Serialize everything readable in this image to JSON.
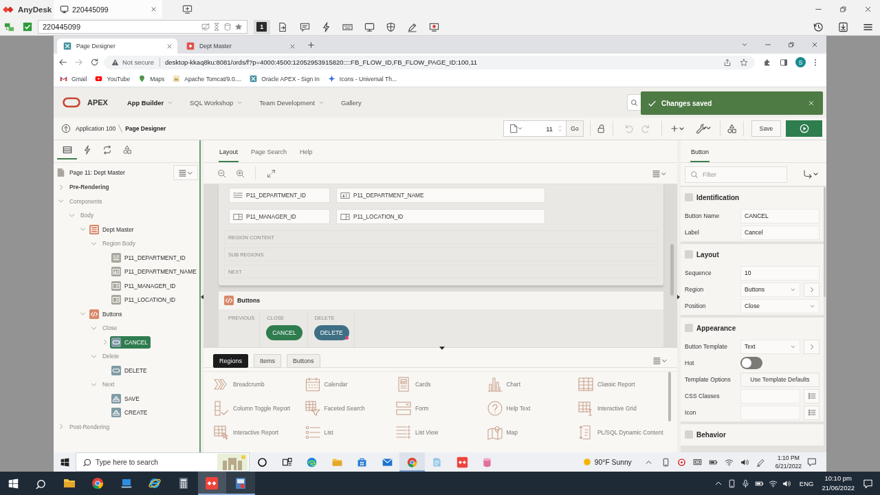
{
  "anydesk": {
    "app_name": "AnyDesk",
    "session_tab": "220445099",
    "address": "220445099",
    "tools": [
      {
        "kind": "display",
        "label": "1",
        "selected": true
      },
      {
        "kind": "transfer",
        "selected": false
      },
      {
        "kind": "chat",
        "selected": false
      },
      {
        "kind": "actions",
        "selected": false
      },
      {
        "kind": "keyboard",
        "selected": false
      },
      {
        "kind": "monitor",
        "selected": false
      },
      {
        "kind": "privacy",
        "selected": false
      },
      {
        "kind": "whiteboard",
        "selected": false
      },
      {
        "kind": "record",
        "selected": false
      }
    ]
  },
  "browser": {
    "tabs": [
      {
        "title": "Page Designer",
        "kind": "apex",
        "selected": true
      },
      {
        "title": "Dept Master",
        "kind": "app",
        "selected": false
      }
    ],
    "security": "Not secure",
    "url": "desktop-kkaq8ku:8081/ords/f?p=4000:4500:12052953915820::::FB_FLOW_ID,FB_FLOW_PAGE_ID:100,11",
    "profile": "S",
    "bookmarks": [
      {
        "label": "Gmail",
        "kind": "gmail"
      },
      {
        "label": "YouTube",
        "kind": "youtube"
      },
      {
        "label": "Maps",
        "kind": "maps"
      },
      {
        "label": "Apache Tomcat/9.0....",
        "kind": "tomcat"
      },
      {
        "label": "Oracle APEX - Sign In",
        "kind": "apex"
      },
      {
        "label": "Icons - Universal Th...",
        "kind": "star"
      }
    ]
  },
  "apex": {
    "brand": "APEX",
    "menus": [
      {
        "label": "App Builder",
        "selected": true,
        "dropdown": true
      },
      {
        "label": "SQL Workshop",
        "selected": false,
        "dropdown": true
      },
      {
        "label": "Team Development",
        "selected": false,
        "dropdown": true
      },
      {
        "label": "Gallery",
        "selected": false,
        "dropdown": false
      }
    ],
    "toast": "Changes saved",
    "breadcrumb": [
      {
        "label": "Application 100",
        "current": false
      },
      {
        "label": "Page Designer",
        "current": true
      }
    ],
    "page_number": "11",
    "go": "Go",
    "history_buttons": [
      {
        "kind": "undo",
        "disabled": true
      },
      {
        "kind": "redo",
        "disabled": true
      }
    ],
    "save": "Save"
  },
  "tree": {
    "tabs": [
      {
        "kind": "rendering",
        "selected": true
      },
      {
        "kind": "dynamic_actions",
        "selected": false
      },
      {
        "kind": "processing",
        "selected": false
      },
      {
        "kind": "shared_components",
        "selected": false
      }
    ],
    "root": "Page 11: Dept Master",
    "nodes": [
      {
        "label": "Pre-Rendering",
        "kind": "heading",
        "expanded": false,
        "selected": false
      },
      {
        "label": "Components",
        "kind": "folder",
        "expanded": true,
        "selected": false,
        "children": [
          {
            "label": "Body",
            "kind": "folder",
            "expanded": true,
            "selected": false,
            "children": [
              {
                "label": "Dept Master",
                "kind": "region",
                "expanded": true,
                "selected": false,
                "children": [
                  {
                    "label": "Region Body",
                    "kind": "folder",
                    "expanded": true,
                    "selected": false,
                    "children": [
                      {
                        "label": "P11_DEPARTMENT_ID",
                        "kind": "text_item",
                        "selected": false
                      },
                      {
                        "label": "P11_DEPARTMENT_NAME",
                        "kind": "display_item",
                        "selected": false
                      },
                      {
                        "label": "P11_MANAGER_ID",
                        "kind": "select_item",
                        "selected": false
                      },
                      {
                        "label": "P11_LOCATION_ID",
                        "kind": "select_item",
                        "selected": false
                      }
                    ]
                  }
                ]
              },
              {
                "label": "Buttons",
                "kind": "code_region",
                "expanded": true,
                "selected": false,
                "children": [
                  {
                    "label": "Close",
                    "kind": "folder",
                    "expanded": true,
                    "selected": false,
                    "children": [
                      {
                        "label": "CANCEL",
                        "kind": "button",
                        "expanded": false,
                        "selected": true
                      }
                    ]
                  },
                  {
                    "label": "Delete",
                    "kind": "folder",
                    "expanded": true,
                    "selected": false,
                    "children": [
                      {
                        "label": "DELETE",
                        "kind": "button",
                        "selected": false
                      }
                    ]
                  },
                  {
                    "label": "Next",
                    "kind": "folder",
                    "expanded": true,
                    "selected": false,
                    "children": [
                      {
                        "label": "SAVE",
                        "kind": "submit_button",
                        "selected": false
                      },
                      {
                        "label": "CREATE",
                        "kind": "submit_button",
                        "selected": false
                      }
                    ]
                  }
                ]
              }
            ]
          }
        ]
      },
      {
        "label": "Post-Rendering",
        "kind": "folder",
        "expanded": false,
        "selected": false
      }
    ]
  },
  "layout": {
    "tabs": [
      {
        "label": "Layout",
        "selected": true
      },
      {
        "label": "Page Search",
        "selected": false
      },
      {
        "label": "Help",
        "selected": false
      }
    ],
    "item_rows": [
      [
        {
          "label": "P11_DEPARTMENT_ID",
          "kind": "text"
        },
        {
          "label": "P11_DEPARTMENT_NAME",
          "kind": "display"
        }
      ],
      [
        {
          "label": "P11_MANAGER_ID",
          "kind": "select"
        },
        {
          "label": "P11_LOCATION_ID",
          "kind": "select"
        }
      ]
    ],
    "positions": [
      "REGION CONTENT",
      "SUB REGIONS",
      "NEXT"
    ],
    "button_region": {
      "title": "Buttons",
      "positions": [
        {
          "label": "PREVIOUS"
        },
        {
          "label": "CLOSE",
          "buttons": [
            {
              "label": "CANCEL",
              "selected": true,
              "marker": false
            }
          ]
        },
        {
          "label": "DELETE",
          "buttons": [
            {
              "label": "DELETE",
              "selected": false,
              "marker": true
            }
          ]
        }
      ]
    }
  },
  "gallery": {
    "tabs": [
      {
        "label": "Regions",
        "selected": true
      },
      {
        "label": "Items",
        "selected": false
      },
      {
        "label": "Buttons",
        "selected": false
      }
    ],
    "items": [
      {
        "label": "Breadcrumb",
        "kind": "breadcrumb"
      },
      {
        "label": "Calendar",
        "kind": "calendar"
      },
      {
        "label": "Cards",
        "kind": "cards"
      },
      {
        "label": "Chart",
        "kind": "chart"
      },
      {
        "label": "Classic Report",
        "kind": "table"
      },
      {
        "label": "Column Toggle Report",
        "kind": "column_toggle"
      },
      {
        "label": "Faceted Search",
        "kind": "faceted"
      },
      {
        "label": "Form",
        "kind": "form"
      },
      {
        "label": "Help Text",
        "kind": "help"
      },
      {
        "label": "Interactive Grid",
        "kind": "grid"
      },
      {
        "label": "Interactive Report",
        "kind": "ireport"
      },
      {
        "label": "List",
        "kind": "list"
      },
      {
        "label": "List View",
        "kind": "listview"
      },
      {
        "label": "Map",
        "kind": "map"
      },
      {
        "label": "PL/SQL Dynamic Content",
        "kind": "plsql"
      }
    ]
  },
  "properties": {
    "tabs": [
      {
        "label": "Button",
        "selected": true
      }
    ],
    "filter_placeholder": "Filter",
    "sections": [
      {
        "title": "Identification",
        "rows": [
          {
            "label": "Button Name",
            "kind": "text",
            "value": "CANCEL"
          },
          {
            "label": "Label",
            "kind": "text",
            "value": "Cancel"
          }
        ]
      },
      {
        "title": "Layout",
        "rows": [
          {
            "label": "Sequence",
            "kind": "text",
            "value": "10"
          },
          {
            "label": "Region",
            "kind": "select_link",
            "value": "Buttons"
          },
          {
            "label": "Position",
            "kind": "select",
            "value": "Close"
          }
        ]
      },
      {
        "title": "Appearance",
        "rows": [
          {
            "label": "Button Template",
            "kind": "select_link",
            "value": "Text"
          },
          {
            "label": "Hot",
            "kind": "switch",
            "on": false
          },
          {
            "label": "Template Options",
            "kind": "button",
            "value": "Use Template Defaults"
          },
          {
            "label": "CSS Classes",
            "kind": "list"
          },
          {
            "label": "Icon",
            "kind": "list"
          }
        ]
      },
      {
        "title": "Behavior"
      }
    ]
  },
  "remote_taskbar": {
    "search_placeholder": "Type here to search",
    "apps": [
      {
        "kind": "cortana",
        "active": false,
        "running": false
      },
      {
        "kind": "task_view",
        "active": false,
        "running": false
      },
      {
        "kind": "edge",
        "active": false,
        "running": false
      },
      {
        "kind": "explorer",
        "active": false,
        "running": false
      },
      {
        "kind": "store",
        "active": false,
        "running": false
      },
      {
        "kind": "mail",
        "active": false,
        "running": false
      },
      {
        "kind": "chrome",
        "active": true,
        "running": true
      },
      {
        "kind": "notepad",
        "active": false,
        "running": false
      },
      {
        "kind": "anydesk",
        "active": false,
        "running": false
      },
      {
        "kind": "database",
        "active": false,
        "running": false
      }
    ],
    "weather": "90°F Sunny",
    "time": "1:10 PM",
    "date": "6/21/2022"
  },
  "local_taskbar": {
    "apps": [
      {
        "kind": "explorer",
        "active": false,
        "running": false
      },
      {
        "kind": "chrome",
        "active": false,
        "running": false
      },
      {
        "kind": "laptop",
        "active": false,
        "running": false
      },
      {
        "kind": "ie",
        "active": false,
        "running": false
      },
      {
        "kind": "calculator",
        "active": false,
        "running": false
      },
      {
        "kind": "anydesk",
        "active": true,
        "running": true
      },
      {
        "kind": "recorder",
        "active": false,
        "running": true
      }
    ],
    "language": "ENG",
    "time": "10:10 pm",
    "date": "21/06/2022"
  }
}
